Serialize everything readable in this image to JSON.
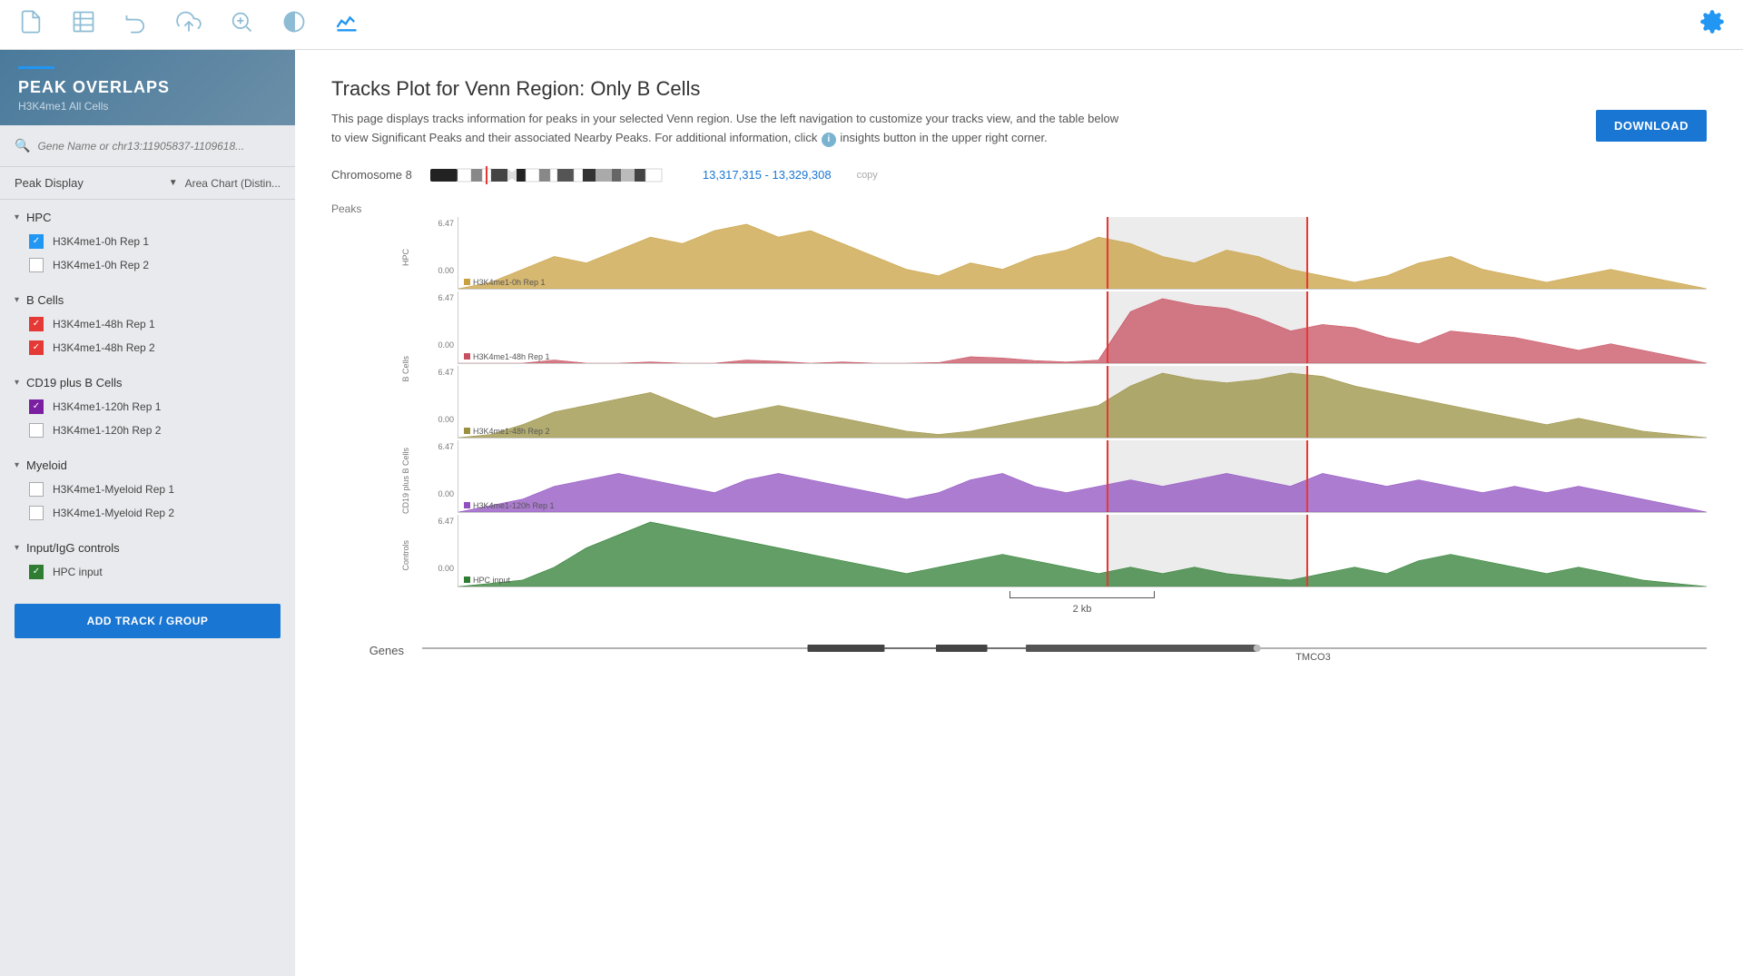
{
  "toolbar": {
    "icons": [
      {
        "name": "file-icon",
        "label": "File"
      },
      {
        "name": "table-icon",
        "label": "Table"
      },
      {
        "name": "undo-icon",
        "label": "Undo"
      },
      {
        "name": "upload-icon",
        "label": "Upload"
      },
      {
        "name": "search-zoom-icon",
        "label": "Search/Zoom"
      },
      {
        "name": "contrast-icon",
        "label": "Contrast"
      },
      {
        "name": "tracks-icon",
        "label": "Tracks",
        "active": true
      }
    ],
    "gear_label": "Settings"
  },
  "sidebar": {
    "accent_bar": true,
    "title": "PEAK OVERLAPS",
    "subtitle": "H3K4me1 All Cells",
    "search_placeholder": "Gene Name or chr13:11905837-1109618...",
    "peak_display_label": "Peak Display",
    "peak_display_value": "Area Chart (Distin...",
    "groups": [
      {
        "name": "HPC",
        "collapsed": false,
        "tracks": [
          {
            "label": "H3K4me1-0h Rep 1",
            "checked": true,
            "color": "blue"
          },
          {
            "label": "H3K4me1-0h Rep 2",
            "checked": false,
            "color": "none"
          }
        ]
      },
      {
        "name": "B Cells",
        "collapsed": false,
        "tracks": [
          {
            "label": "H3K4me1-48h Rep 1",
            "checked": true,
            "color": "red"
          },
          {
            "label": "H3K4me1-48h Rep 2",
            "checked": true,
            "color": "red"
          }
        ]
      },
      {
        "name": "CD19 plus B Cells",
        "collapsed": false,
        "tracks": [
          {
            "label": "H3K4me1-120h Rep 1",
            "checked": true,
            "color": "purple"
          },
          {
            "label": "H3K4me1-120h Rep 2",
            "checked": false,
            "color": "none"
          }
        ]
      },
      {
        "name": "Myeloid",
        "collapsed": false,
        "tracks": [
          {
            "label": "H3K4me1-Myeloid Rep 1",
            "checked": false,
            "color": "none"
          },
          {
            "label": "H3K4me1-Myeloid Rep 2",
            "checked": false,
            "color": "none"
          }
        ]
      },
      {
        "name": "Input/IgG controls",
        "collapsed": false,
        "tracks": [
          {
            "label": "HPC input",
            "checked": true,
            "color": "green"
          }
        ]
      }
    ],
    "add_track_label": "ADD TRACK / GROUP"
  },
  "content": {
    "page_title": "Tracks Plot for Venn Region: Only B Cells",
    "description": "This page displays tracks information for peaks in your selected Venn region. Use the left navigation to customize your tracks view, and the table below to view Significant Peaks and their associated Nearby Peaks. For additional information, click",
    "description_suffix": "insights button in the upper right corner.",
    "download_label": "DOWNLOAD",
    "chromosome": "Chromosome 8",
    "chr_range": "13,317,315 - 13,329,308",
    "chr_copy": "copy",
    "peaks_label": "Peaks",
    "genes_label": "Genes",
    "gene_name": "TMCO3",
    "scale_label": "2 kb",
    "tracks": [
      {
        "group_label": "HPC",
        "color": "#c8a040",
        "legend": "H3K4me1-0h Rep 1",
        "max_val": "6.47",
        "min_val": "0.00"
      },
      {
        "group_label": "B Cells",
        "color": "#c85060",
        "legend": "H3K4me1-48h Rep 1",
        "max_val": "6.47",
        "min_val": "0.00"
      },
      {
        "group_label": "B Cells",
        "color": "#9a9040",
        "legend": "H3K4me1-48h Rep 2",
        "max_val": "6.47",
        "min_val": "0.00"
      },
      {
        "group_label": "CD19 plus B Cells",
        "color": "#9050c0",
        "legend": "H3K4me1-120h Rep 1",
        "max_val": "6.47",
        "min_val": "0.00"
      },
      {
        "group_label": "Controls",
        "color": "#2e7d32",
        "legend": "HPC input",
        "max_val": "6.47",
        "min_val": "0.00"
      }
    ]
  }
}
